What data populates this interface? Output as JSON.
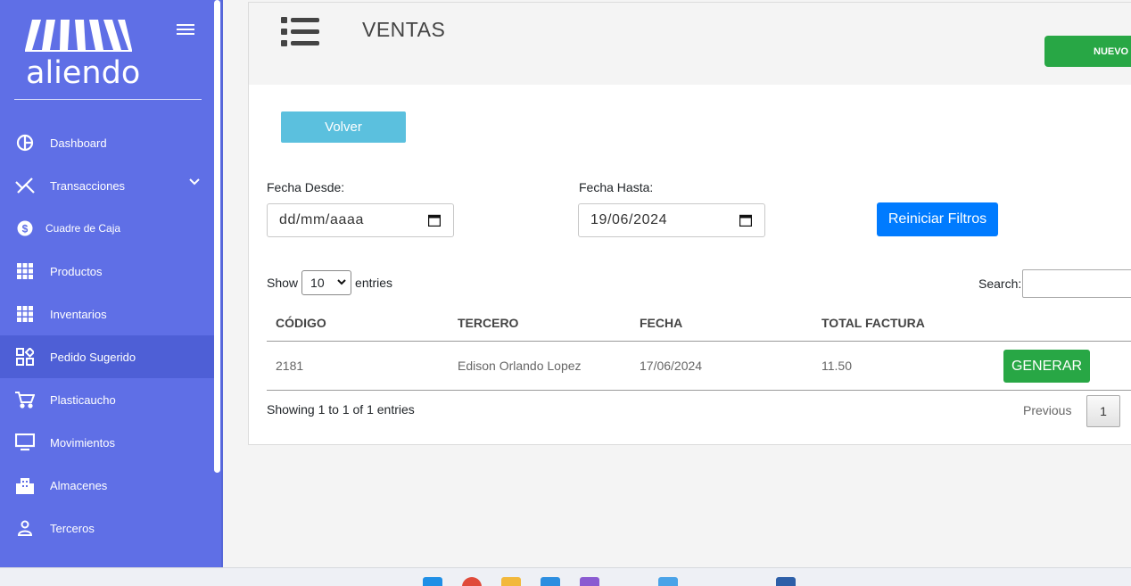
{
  "sidebar": {
    "brand_name": "aliendo",
    "items": [
      {
        "label": "Dashboard",
        "icon": "dashboard-icon"
      },
      {
        "label": "Transacciones",
        "icon": "transactions-icon"
      },
      {
        "label": "Cuadre de Caja",
        "icon": "cash-icon"
      },
      {
        "label": "Productos",
        "icon": "grid-icon"
      },
      {
        "label": "Inventarios",
        "icon": "grid-icon"
      },
      {
        "label": "Pedido Sugerido",
        "icon": "widgets-icon"
      },
      {
        "label": "Plasticaucho",
        "icon": "cart-icon"
      },
      {
        "label": "Movimientos",
        "icon": "monitor-icon"
      },
      {
        "label": "Almacenes",
        "icon": "building-icon"
      },
      {
        "label": "Terceros",
        "icon": "person-icon"
      }
    ],
    "active_item": "Pedido Sugerido"
  },
  "header": {
    "title": "VENTAS",
    "new_button": "NUEVO"
  },
  "filters": {
    "back_button": "Volver",
    "from_label": "Fecha Desde:",
    "from_value": "dd/mm/aaaa",
    "to_label": "Fecha Hasta:",
    "to_value": "19/06/2024",
    "reset_button": "Reiniciar Filtros"
  },
  "table": {
    "show_label": "Show",
    "page_size": "10",
    "entries_label": "entries",
    "search_label": "Search:",
    "columns": [
      "CÓDIGO",
      "TERCERO",
      "FECHA",
      "TOTAL FACTURA"
    ],
    "rows": [
      {
        "codigo": "2181",
        "tercero": "Edison Orlando Lopez",
        "fecha": "17/06/2024",
        "total": "11.50",
        "action": "GENERAR"
      }
    ],
    "info": "Showing 1 to 1 of 1 entries",
    "previous": "Previous",
    "current_page": "1"
  },
  "colors": {
    "sidebar": "#5f6fe6",
    "active_item": "#4e5fd6",
    "success": "#28a745",
    "info": "#5bc0de",
    "primary": "#007bff"
  }
}
